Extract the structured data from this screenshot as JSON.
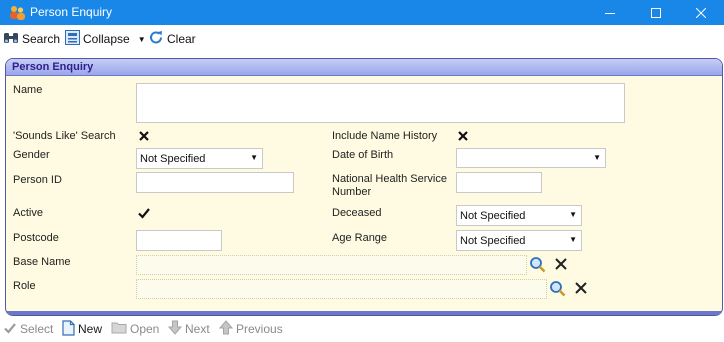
{
  "window": {
    "title": "Person Enquiry"
  },
  "toolbar": {
    "search_label": "Search",
    "collapse_label": "Collapse",
    "clear_label": "Clear"
  },
  "panel": {
    "title": "Person Enquiry"
  },
  "form": {
    "name_label": "Name",
    "sounds_like_label": "'Sounds Like' Search",
    "sounds_like_checked": true,
    "include_history_label": "Include Name History",
    "include_history_checked": true,
    "gender_label": "Gender",
    "gender_value": "Not Specified",
    "dob_label": "Date of Birth",
    "dob_value": "",
    "person_id_label": "Person ID",
    "nhs_label": "National Health Service Number",
    "active_label": "Active",
    "active_checked": true,
    "deceased_label": "Deceased",
    "deceased_value": "Not Specified",
    "postcode_label": "Postcode",
    "age_range_label": "Age Range",
    "age_range_value": "Not Specified",
    "base_name_label": "Base Name",
    "role_label": "Role"
  },
  "footer": {
    "select_label": "Select",
    "new_label": "New",
    "open_label": "Open",
    "next_label": "Next",
    "previous_label": "Previous"
  },
  "icons": {
    "app": "people-icon",
    "search": "binoculars-icon",
    "collapse": "collapse-icon",
    "clear": "refresh-icon",
    "lookup": "magnifier-icon",
    "clear_field": "x-icon"
  }
}
